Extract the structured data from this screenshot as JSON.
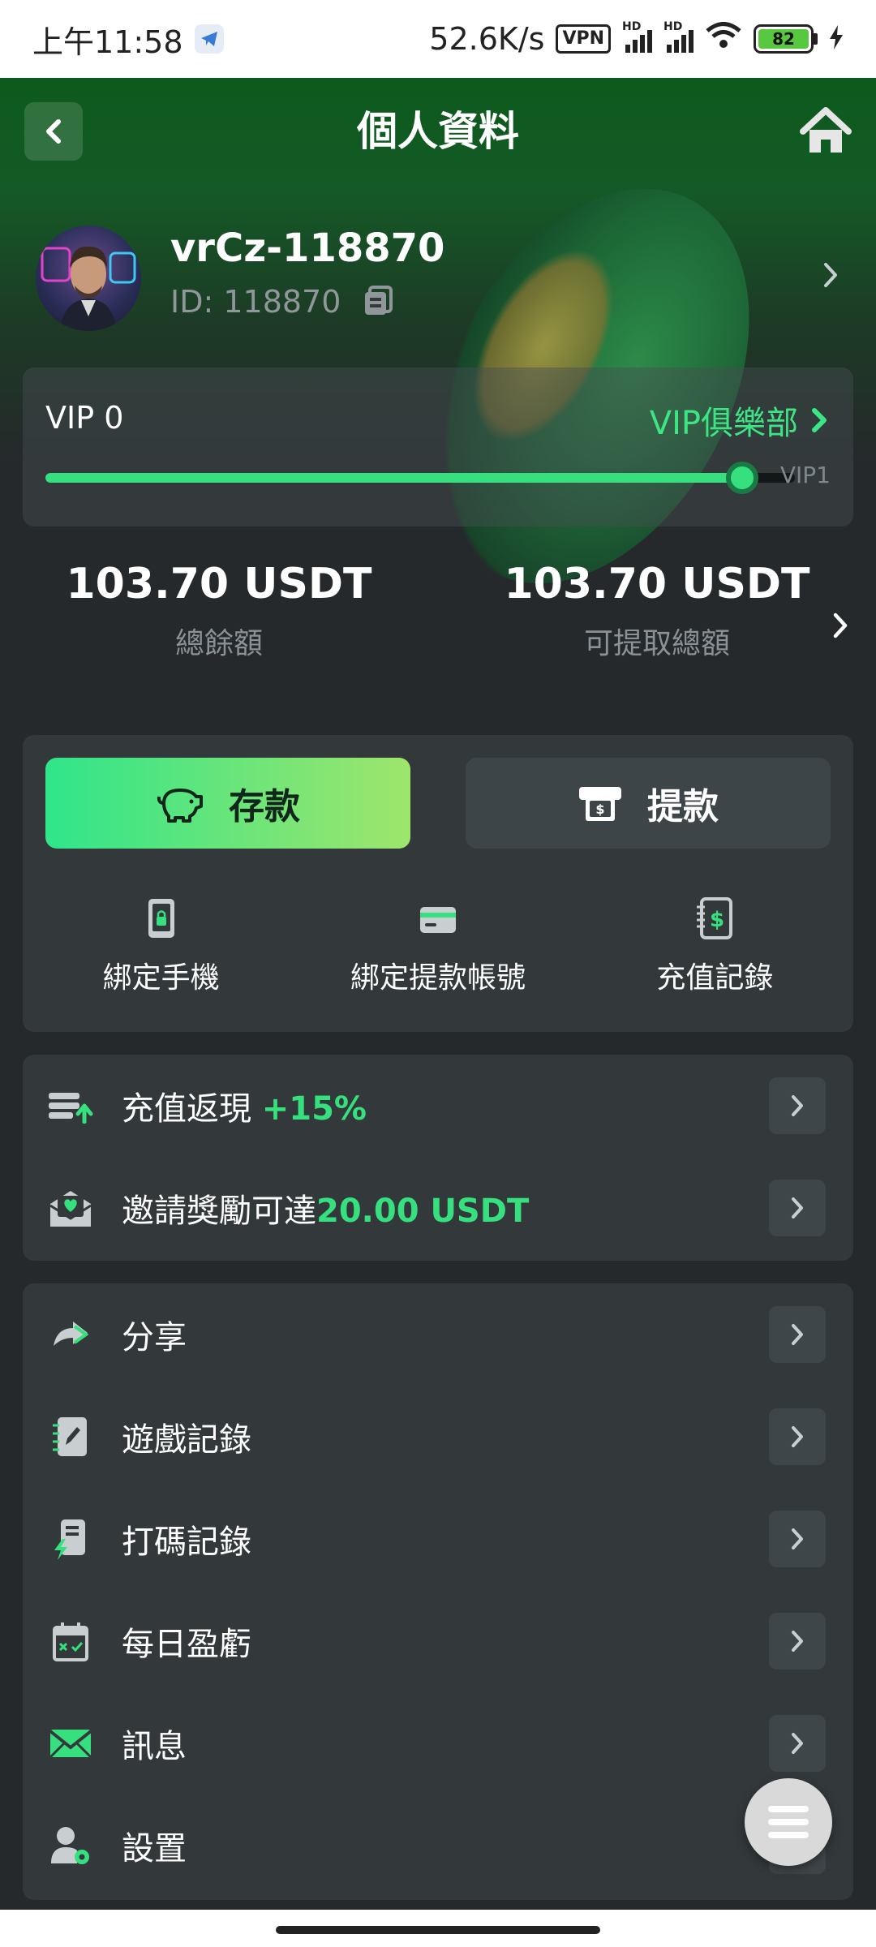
{
  "status_bar": {
    "time": "上午11:58",
    "net_speed": "52.6K/s",
    "vpn": "VPN",
    "hd1": "HD",
    "hd2": "HD",
    "battery": "82"
  },
  "header": {
    "title": "個人資料"
  },
  "profile": {
    "username": "vrCz-118870",
    "user_id": "ID: 118870"
  },
  "vip": {
    "level": "VIP 0",
    "club_label": "VIP俱樂部",
    "next_level": "VIP1",
    "progress": 0.93
  },
  "balances": {
    "total": {
      "amount": "103.70 USDT",
      "label": "總餘額"
    },
    "withdrawable": {
      "amount": "103.70 USDT",
      "label": "可提取總額"
    }
  },
  "actions": {
    "deposit": "存款",
    "withdraw": "提款",
    "shortcuts": [
      {
        "label": "綁定手機",
        "icon": "phone-lock-icon"
      },
      {
        "label": "綁定提款帳號",
        "icon": "card-icon"
      },
      {
        "label": "充值記錄",
        "icon": "dollar-notebook-icon"
      }
    ]
  },
  "promos": [
    {
      "text": "充值返現 ",
      "highlight": "+15%",
      "icon": "recharge-cashback-icon"
    },
    {
      "text": "邀請獎勵可達",
      "highlight": "20.00 USDT",
      "icon": "invite-envelope-icon"
    }
  ],
  "menu": [
    {
      "label": "分享",
      "icon": "share-icon"
    },
    {
      "label": "遊戲記錄",
      "icon": "game-record-icon"
    },
    {
      "label": "打碼記錄",
      "icon": "bet-record-icon"
    },
    {
      "label": "每日盈虧",
      "icon": "calendar-icon"
    },
    {
      "label": "訊息",
      "icon": "mail-icon"
    },
    {
      "label": "設置",
      "icon": "user-settings-icon"
    }
  ],
  "colors": {
    "accent": "#36e07e",
    "background": "#25292b",
    "panel": "#33393b",
    "hero_green": "#0d5a1d"
  }
}
